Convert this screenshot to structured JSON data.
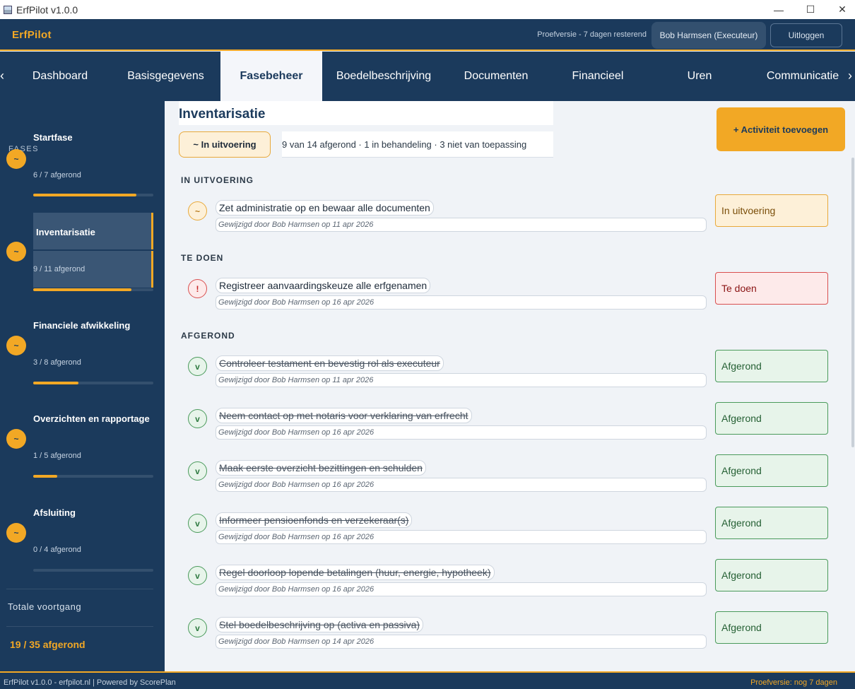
{
  "window": {
    "title": "ErfPilot v1.0.0",
    "minimize": "—",
    "maximize": "☐",
    "close": "✕"
  },
  "header": {
    "brand": "ErfPilot",
    "trial": "Proefversie - 7 dagen resterend",
    "user": "Bob Harmsen (Executeur)",
    "logout": "Uitloggen"
  },
  "tabs": {
    "prev_arrow": "‹",
    "next_arrow": "›",
    "items": [
      "Dashboard",
      "Basisgegevens",
      "Fasebeheer",
      "Boedelbeschrijving",
      "Documenten",
      "Financieel",
      "Uren",
      "Communicatie"
    ],
    "active": "Fasebeheer"
  },
  "sidebar": {
    "label": "FASES",
    "phases": [
      {
        "name": "Startfase",
        "count": "6 / 7 afgerond",
        "icon": "~",
        "progress": 0.857
      },
      {
        "name": "Inventarisatie",
        "count": "9 / 11 afgerond",
        "icon": "~",
        "progress": 0.818,
        "active": true
      },
      {
        "name": "Financiele afwikkeling",
        "count": "3 / 8 afgerond",
        "icon": "~",
        "progress": 0.375
      },
      {
        "name": "Overzichten en rapportage",
        "count": "1 / 5 afgerond",
        "icon": "~",
        "progress": 0.2
      },
      {
        "name": "Afsluiting",
        "count": "0 / 4 afgerond",
        "icon": "~",
        "progress": 0
      }
    ],
    "total_label": "Totale voortgang",
    "total_value": "19 / 35 afgerond"
  },
  "main": {
    "title": "Inventarisatie",
    "status_chip": "~  In uitvoering",
    "summary": "9 van 14 afgerond  ·  1 in behandeling  ·  3 niet van toepassing",
    "add_button": "+ Activiteit toevoegen",
    "sections": {
      "in_progress": "IN UITVOERING",
      "todo": "TE DOEN",
      "done": "AFGEROND"
    },
    "activities": [
      {
        "icon": "~",
        "title": "Zet administratie op en bewaar alle documenten",
        "meta": "Gewijzigd door Bob Harmsen op 11 apr 2026",
        "status": "In uitvoering"
      },
      {
        "icon": "!",
        "title": "Registreer aanvaardingskeuze alle erfgenamen",
        "meta": "Gewijzigd door Bob Harmsen op 16 apr 2026",
        "status": "Te doen"
      },
      {
        "icon": "v",
        "title": "Controleer testament en bevestig rol als executeur",
        "meta": "Gewijzigd door Bob Harmsen op 11 apr 2026",
        "status": "Afgerond"
      },
      {
        "icon": "v",
        "title": "Neem contact op met notaris voor verklaring van erfrecht",
        "meta": "Gewijzigd door Bob Harmsen op 16 apr 2026",
        "status": "Afgerond"
      },
      {
        "icon": "v",
        "title": "Maak eerste overzicht bezittingen en schulden",
        "meta": "Gewijzigd door Bob Harmsen op 16 apr 2026",
        "status": "Afgerond"
      },
      {
        "icon": "v",
        "title": "Informeer pensioenfonds en verzekeraar(s)",
        "meta": "Gewijzigd door Bob Harmsen op 16 apr 2026",
        "status": "Afgerond"
      },
      {
        "icon": "v",
        "title": "Regel doorloop lopende betalingen (huur, energie, hypotheek)",
        "meta": "Gewijzigd door Bob Harmsen op 16 apr 2026",
        "status": "Afgerond"
      },
      {
        "icon": "v",
        "title": "Stel boedelbeschrijving op (activa en passiva)",
        "meta": "Gewijzigd door Bob Harmsen op 14 apr 2026",
        "status": "Afgerond"
      }
    ]
  },
  "footer": {
    "left": "ErfPilot v1.0.0  -  erfpilot.nl   |  Powered by ScorePlan",
    "right": "Proefversie: nog 7 dagen"
  },
  "colors": {
    "navy": "#1b3a5c",
    "accent": "#f2a825",
    "done": "#4a9a5b",
    "todo": "#d94f4f"
  }
}
